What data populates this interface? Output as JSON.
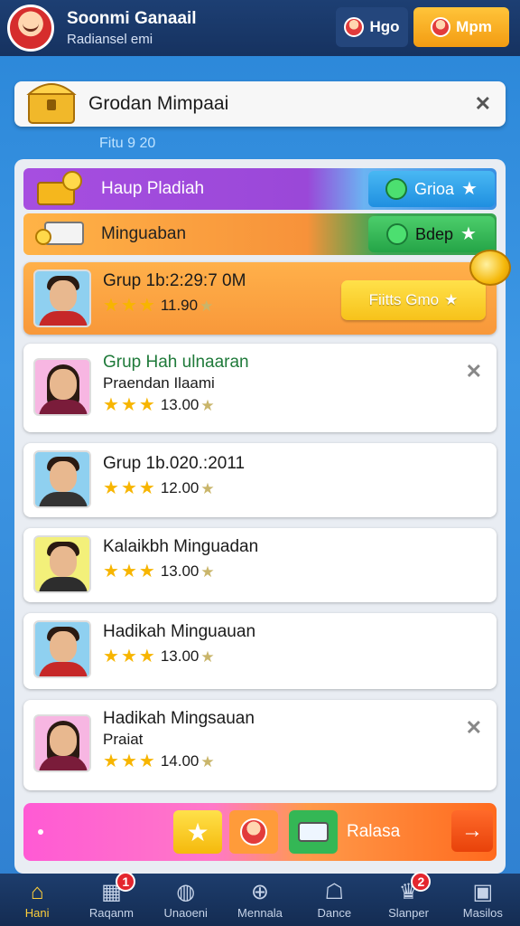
{
  "header": {
    "title": "Soonmi Ganaail",
    "subtitle": "Radiansel emi",
    "chip_1_label": "Hgo",
    "chip_2_label": "Mpm"
  },
  "head_card": {
    "title": "Grodan Mimpaai"
  },
  "filter_label": "Fitu 9 20",
  "bands": [
    {
      "label": "Haup Pladiah",
      "button_label": "Grioa"
    },
    {
      "label": "Minguaban",
      "button_label": "Bdep"
    }
  ],
  "rows": [
    {
      "title": "Grup 1b:2:29:7 0M",
      "rating": "11.90",
      "cta_label": "Fiitts Gmo"
    },
    {
      "title": "Grup Hah ulnaaran",
      "subtitle": "Praendan Ilaami",
      "rating": "13.00"
    },
    {
      "title": "Grup 1b.020.:2011",
      "rating": "12.00"
    },
    {
      "title": "Kalaikbh Minguadan",
      "rating": "13.00"
    },
    {
      "title": "Hadikah Minguauan",
      "rating": "13.00"
    },
    {
      "title": "Hadikah Mingsauan",
      "subtitle": "Praiat",
      "rating": "14.00"
    }
  ],
  "promo": {
    "label": "Ralasa"
  },
  "nav": [
    {
      "label": "Hani",
      "icon": "home-icon"
    },
    {
      "label": "Raqanm",
      "icon": "shop-icon",
      "badge": "1"
    },
    {
      "label": "Unaoeni",
      "icon": "globe-icon"
    },
    {
      "label": "Mennala",
      "icon": "plus-icon"
    },
    {
      "label": "Dance",
      "icon": "chat-icon"
    },
    {
      "label": "Slanper",
      "icon": "trophy-icon",
      "badge": "2"
    },
    {
      "label": "Masilos",
      "icon": "game-icon"
    }
  ],
  "colors": {
    "accent_yellow": "#ffcf3a",
    "top_bar": "#1d3f73",
    "badge_red": "#e4262e"
  }
}
